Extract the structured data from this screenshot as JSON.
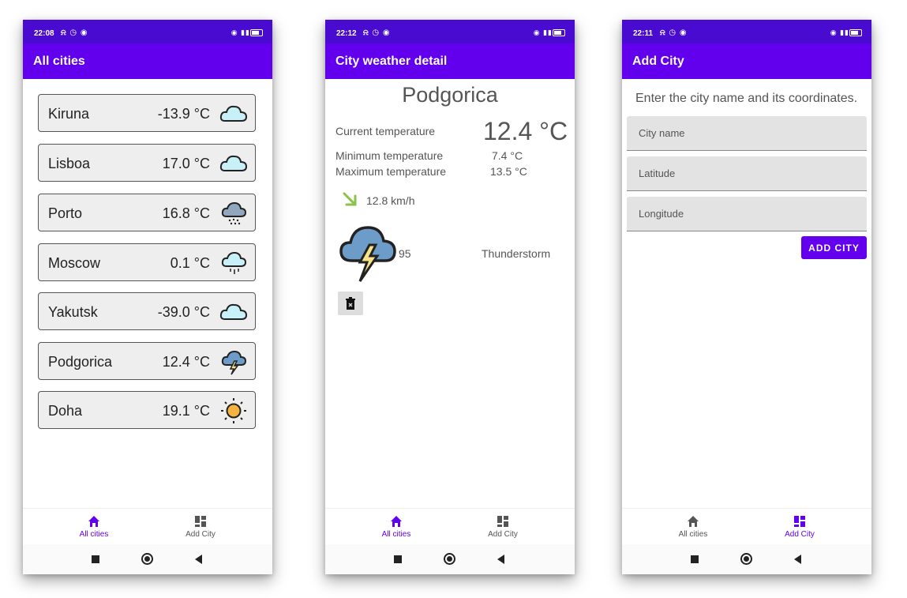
{
  "screens": [
    {
      "status_time": "22:08",
      "app_title": "All cities",
      "cities": [
        {
          "name": "Kiruna",
          "temp": "-13.9 °C",
          "icon": "cloud-icon"
        },
        {
          "name": "Lisboa",
          "temp": "17.0 °C",
          "icon": "cloud-icon"
        },
        {
          "name": "Porto",
          "temp": "16.8 °C",
          "icon": "snow-cloud-icon"
        },
        {
          "name": "Moscow",
          "temp": "0.1 °C",
          "icon": "drizzle-cloud-icon"
        },
        {
          "name": "Yakutsk",
          "temp": "-39.0 °C",
          "icon": "cloud-icon"
        },
        {
          "name": "Podgorica",
          "temp": "12.4 °C",
          "icon": "thunderstorm-icon"
        },
        {
          "name": "Doha",
          "temp": "19.1 °C",
          "icon": "sun-icon"
        }
      ]
    },
    {
      "status_time": "22:12",
      "app_title": "City weather detail",
      "city": "Podgorica",
      "current_label": "Current temperature",
      "current_value": "12.4 °C",
      "min_label": "Minimum temperature",
      "min_value": "7.4 °C",
      "max_label": "Maximum temperature",
      "max_value": "13.5 °C",
      "wind": "12.8 km/h",
      "humidity": "95",
      "description": "Thunderstorm"
    },
    {
      "status_time": "22:11",
      "app_title": "Add City",
      "hint": "Enter the city name and its coordinates.",
      "city_name_placeholder": "City name",
      "latitude_placeholder": "Latitude",
      "longitude_placeholder": "Longitude",
      "add_button": "ADD CITY"
    }
  ],
  "nav": {
    "all_cities": "All cities",
    "add_city": "Add City"
  },
  "colors": {
    "primary": "#6200ee",
    "status_bar": "#4a0bd1"
  }
}
